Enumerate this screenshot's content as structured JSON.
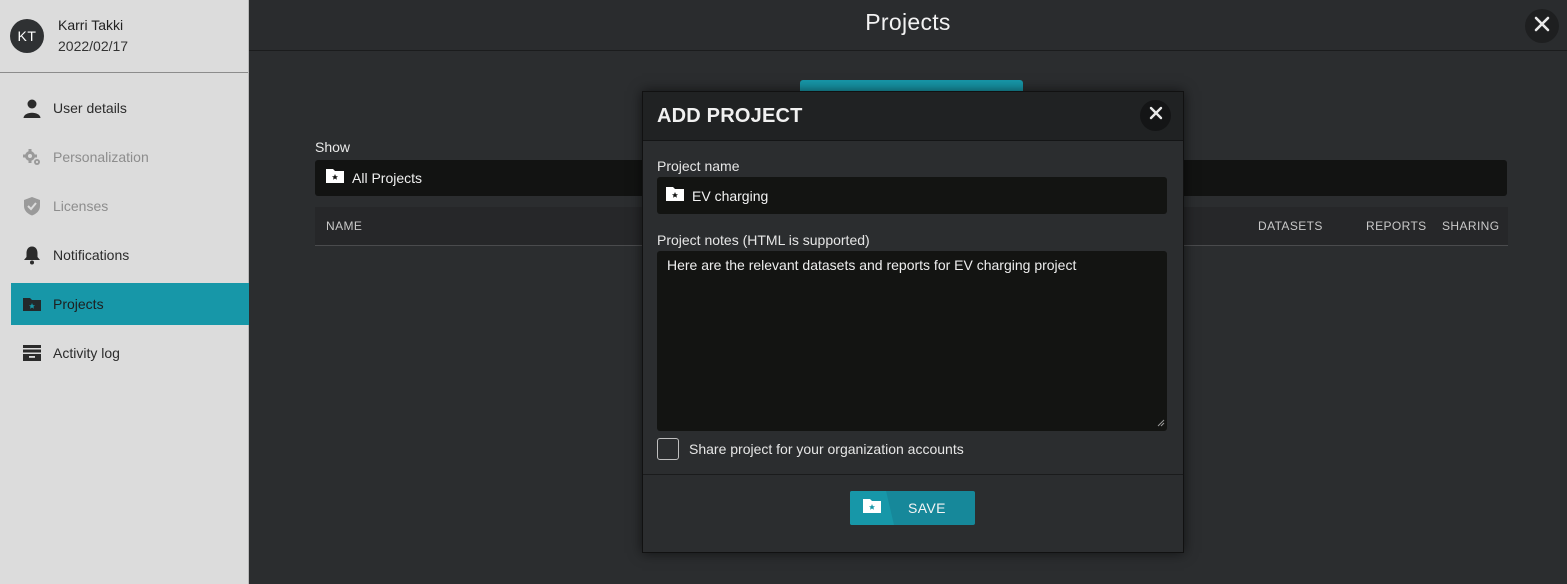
{
  "user": {
    "initials": "KT",
    "name": "Karri Takki",
    "date": "2022/02/17"
  },
  "sidebar": {
    "items": [
      {
        "label": "User details",
        "icon": "user-icon",
        "state": "normal"
      },
      {
        "label": "Personalization",
        "icon": "gear-icon",
        "state": "disabled"
      },
      {
        "label": "Licenses",
        "icon": "shield-icon",
        "state": "disabled"
      },
      {
        "label": "Notifications",
        "icon": "bell-icon",
        "state": "normal"
      },
      {
        "label": "Projects",
        "icon": "folder-star-icon",
        "state": "active"
      },
      {
        "label": "Activity log",
        "icon": "archive-icon",
        "state": "normal"
      }
    ]
  },
  "main": {
    "title": "Projects",
    "show_label": "Show",
    "show_value": "All Projects",
    "columns": {
      "name": "NAME",
      "datasets": "DATASETS",
      "reports": "REPORTS",
      "sharing": "SHARING"
    }
  },
  "modal": {
    "title": "ADD PROJECT",
    "name_label": "Project name",
    "name_value": "EV charging",
    "notes_label": "Project notes (HTML is supported)",
    "notes_value": "Here are the relevant datasets and reports for EV charging project",
    "share_label": "Share project for your organization accounts",
    "share_checked": false,
    "save_label": "SAVE"
  },
  "colors": {
    "accent": "#1797a8",
    "sidebar_bg": "#dcdcdc",
    "main_bg": "#2b2d2f",
    "input_bg": "#131412"
  }
}
